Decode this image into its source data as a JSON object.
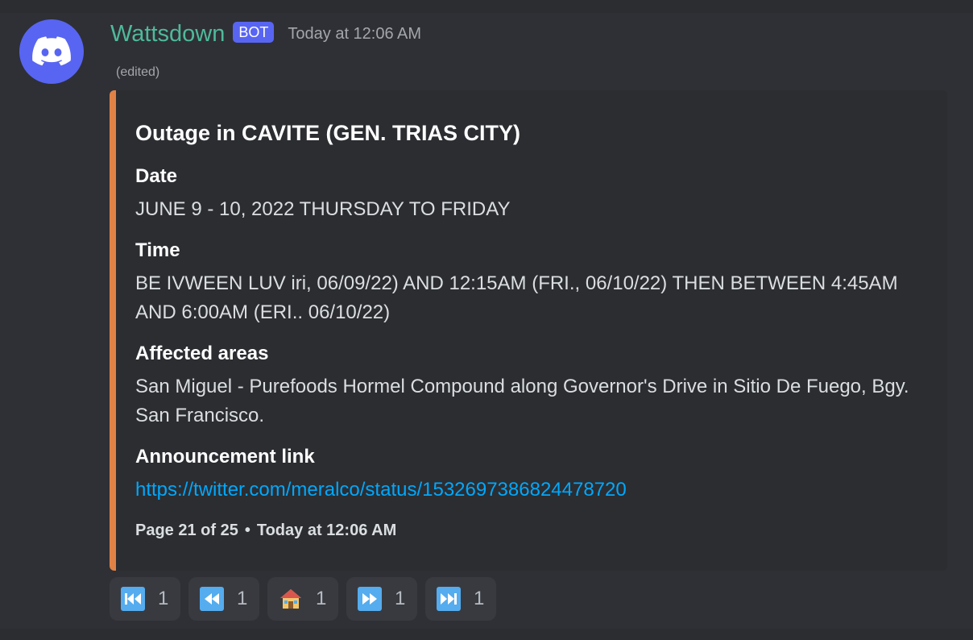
{
  "message": {
    "username": "Wattsdown",
    "bot_tag": "BOT",
    "timestamp": "Today at 12:06 AM",
    "edited_label": "(edited)"
  },
  "embed": {
    "accent_color": "#e08246",
    "title": "Outage in CAVITE (GEN. TRIAS CITY)",
    "fields": [
      {
        "name": "Date",
        "value": "JUNE 9 - 10, 2022 THURSDAY TO FRIDAY"
      },
      {
        "name": "Time",
        "value": "BE IVWEEN LUV iri, 06/09/22) AND 12:15AM (FRI., 06/10/22) THEN BETWEEN 4:45AM AND 6:00AM (ERI.. 06/10/22)"
      },
      {
        "name": "Affected areas",
        "value": "San Miguel - Purefoods Hormel Compound along Governor's Drive in Sitio De Fuego, Bgy. San Francisco."
      },
      {
        "name": "Announcement link",
        "value": "https://twitter.com/meralco/status/1532697386824478720"
      }
    ],
    "footer": {
      "page": "Page 21 of 25",
      "separator": "•",
      "timestamp": "Today at 12:06 AM"
    }
  },
  "reactions": [
    {
      "icon": "first-page-icon",
      "count": "1"
    },
    {
      "icon": "rewind-icon",
      "count": "1"
    },
    {
      "icon": "house-icon",
      "count": "1"
    },
    {
      "icon": "fast-forward-icon",
      "count": "1"
    },
    {
      "icon": "last-page-icon",
      "count": "1"
    }
  ],
  "colors": {
    "brand": "#5865f2",
    "username": "#4fb99b",
    "link": "#00a8fc"
  }
}
